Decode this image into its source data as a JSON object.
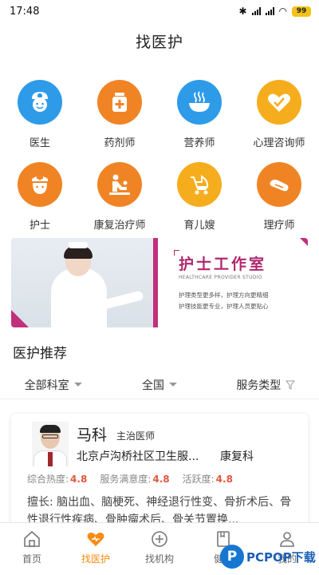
{
  "status": {
    "time": "17:48",
    "battery": "99"
  },
  "page": {
    "title": "找医护"
  },
  "categories": [
    {
      "label": "医生",
      "icon": "doctor-icon",
      "color": "#2e9be8"
    },
    {
      "label": "药剂师",
      "icon": "medicine-bottle-icon",
      "color": "#f08425"
    },
    {
      "label": "营养师",
      "icon": "food-bowl-icon",
      "color": "#2e9be8"
    },
    {
      "label": "心理咨询师",
      "icon": "heart-icon",
      "color": "#f6ad1d"
    },
    {
      "label": "护士",
      "icon": "nurse-icon",
      "color": "#f08425"
    },
    {
      "label": "康复治疗师",
      "icon": "rehab-icon",
      "color": "#f08425"
    },
    {
      "label": "育儿嫂",
      "icon": "stroller-icon",
      "color": "#f6ad1d"
    },
    {
      "label": "理疗师",
      "icon": "physio-icon",
      "color": "#f08425"
    }
  ],
  "banner": {
    "title": "护士工作室",
    "subtitle": "HEALTHCARE PROVIDER STUDIO",
    "line1": "护理类型更多样，护理方向更精细",
    "line2": "护理技能更专业，护理人员更贴心"
  },
  "section": {
    "title": "医护推荐"
  },
  "filters": [
    {
      "label": "全部科室",
      "icon": "caret-down-icon"
    },
    {
      "label": "全国",
      "icon": "caret-down-icon"
    },
    {
      "label": "服务类型",
      "icon": "filter-icon"
    }
  ],
  "doctor": {
    "name": "马科",
    "title": "主治医师",
    "hospital": "北京卢沟桥社区卫生服...",
    "department": "康复科",
    "stats": [
      {
        "label": "综合热度:",
        "value": "4.8"
      },
      {
        "label": "服务满意度:",
        "value": "4.8"
      },
      {
        "label": "活跃度:",
        "value": "4.8"
      }
    ],
    "skills": "擅长: 脑出血、脑梗死、神经退行性变、骨折术后、骨性退行性疾病、骨肿瘤术后、骨关节置换..."
  },
  "tabs": [
    {
      "label": "首页",
      "icon": "home-icon"
    },
    {
      "label": "找医护",
      "icon": "heart-icon"
    },
    {
      "label": "找机构",
      "icon": "plus-circle-icon"
    },
    {
      "label": "健康",
      "icon": "document-icon"
    },
    {
      "label": "我的",
      "icon": "user-icon"
    }
  ],
  "active_tab": "找医护",
  "colors": {
    "accent": "#ff8a10",
    "banner_accent": "#c0307c",
    "stat_value": "#e0573f"
  },
  "watermark": {
    "letter": "P",
    "text": "PCPOP下载"
  }
}
